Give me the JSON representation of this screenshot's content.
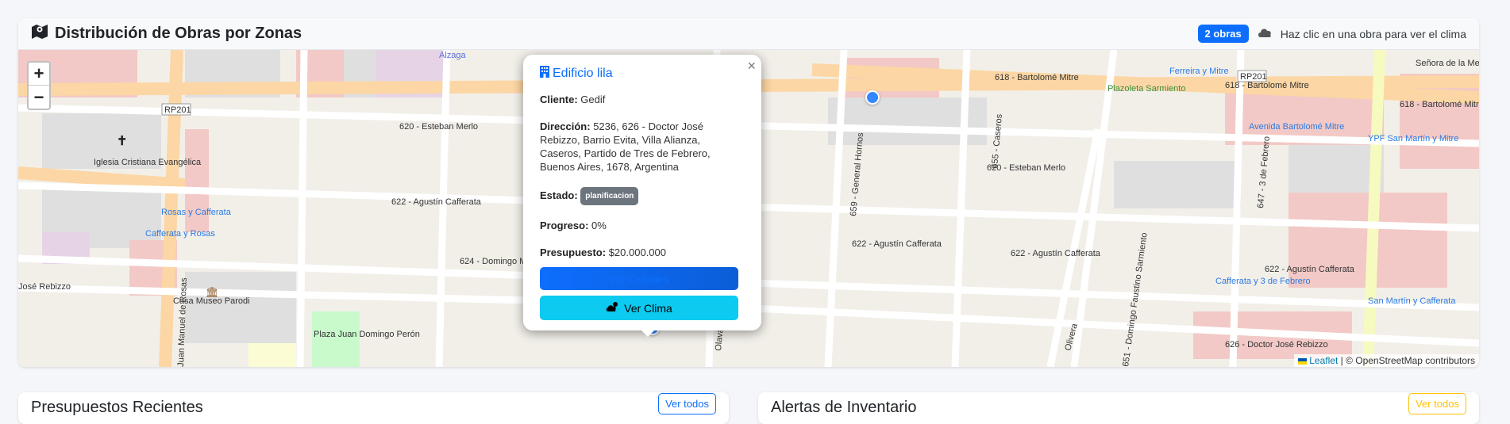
{
  "header": {
    "title": "Distribución de Obras por Zonas",
    "badge": "2 obras",
    "hint": "Haz clic en una obra para ver el clima"
  },
  "map": {
    "zoom_in": "+",
    "zoom_out": "−",
    "labels": {
      "calle_618": "618 - Bartolomé Mitre",
      "calle_620": "620 - Esteban Merlo",
      "calle_620b": "620 - Esteban Merlo",
      "calle_622a": "622 - Agustín Cafferata",
      "calle_622b": "622 - Agustín Cafferata",
      "calle_622c": "622 - Agustín Cafferata",
      "calle_622d": "622 - Agustín Cafferata",
      "calle_624": "624 - Domingo M",
      "calle_626": "626 - Doctor José Rebizzo",
      "rp201a": "RP201",
      "rp201b": "RP201",
      "caseros": "655 - Caseros",
      "hornos": "659 - General Hornos",
      "febrero": "647 - 3 de Febrero",
      "sarmiento": "651 - Domingo Faustino Sarmiento",
      "iglesia": "Iglesia Cristiana Evangélica",
      "museo": "Casa Museo Parodi",
      "plaza": "Plaza Juan Domingo Perón",
      "plazoleta": "Plazoleta Sarmiento",
      "rosas_cafferata": "Rosas y Cafferata",
      "cafferata_rosas": "Cafferata y Rosas",
      "ypf": "YPF San Martín y Mitre",
      "avenida": "Avenida Bartolomé Mitre",
      "ferreira": "Ferreira y Mitre",
      "merced": "Señora de la Merced",
      "cafferata_3": "Cafferata y 3 de Febrero",
      "sanmartin": "San Martín y Cafferata",
      "alzaga": "Alzaga",
      "rebizzo_left": "José Rebizzo",
      "olivera": "Olivera",
      "olavarria": "Olavarr",
      "manuel_rosas": "Juan Manuel de Rosas"
    },
    "attribution_leaflet": "Leaflet",
    "attribution_rest": "| © OpenStreetMap contributors"
  },
  "popup": {
    "close": "×",
    "title": "Edificio lila",
    "cliente_label": "Cliente:",
    "cliente": "Gedif",
    "direccion_label": "Dirección:",
    "direccion": "5236, 626 - Doctor José Rebizzo, Barrio Evita, Villa Alianza, Caseros, Partido de Tres de Febrero, Buenos Aires, 1678, Argentina",
    "estado_label": "Estado:",
    "estado": "planificacion",
    "progreso_label": "Progreso:",
    "progreso": "0%",
    "presupuesto_label": "Presupuesto:",
    "presupuesto": "$20.000.000",
    "btn_detalles": "Ver Detalles",
    "btn_clima": "Ver Clima"
  },
  "lower": {
    "left_title": "Presupuestos Recientes",
    "left_btn": "Ver todos",
    "right_title": "Alertas de Inventario",
    "right_btn": "Ver todos"
  },
  "colors": {
    "primary": "#0d6efd",
    "info": "#0dcaf0",
    "secondary": "#6c757d",
    "warning": "#ffc107"
  }
}
